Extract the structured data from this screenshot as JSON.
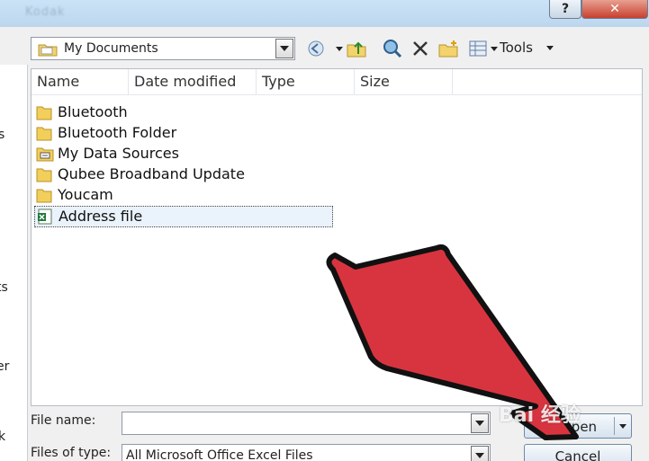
{
  "window": {
    "title": "Kodak",
    "help_label": "?",
    "close_label": "✕"
  },
  "toolbar": {
    "look_in_value": "My Documents",
    "tools_label": "Tools"
  },
  "columns": [
    "Name",
    "Date modified",
    "Type",
    "Size"
  ],
  "files": [
    {
      "name": "Bluetooth",
      "icon": "folder-icon"
    },
    {
      "name": "Bluetooth Folder",
      "icon": "folder-icon"
    },
    {
      "name": "My Data Sources",
      "icon": "data-sources-folder-icon"
    },
    {
      "name": "Qubee Broadband Update",
      "icon": "folder-icon"
    },
    {
      "name": "Youcam",
      "icon": "folder-icon"
    },
    {
      "name": "Address file",
      "icon": "excel-file-icon",
      "selected": true
    }
  ],
  "sidebar_fragments": [
    "s",
    "ts",
    "er",
    "k"
  ],
  "file_name": {
    "label": "File name:",
    "value": ""
  },
  "file_type": {
    "label": "Files of type:",
    "value": "All Microsoft Office Excel Files"
  },
  "buttons": {
    "open": "Open",
    "cancel": "Cancel"
  },
  "watermark": "Bai 经验",
  "colors": {
    "arrow": "#d8343f",
    "selection": "#eaf3fc",
    "close": "#c84030"
  }
}
